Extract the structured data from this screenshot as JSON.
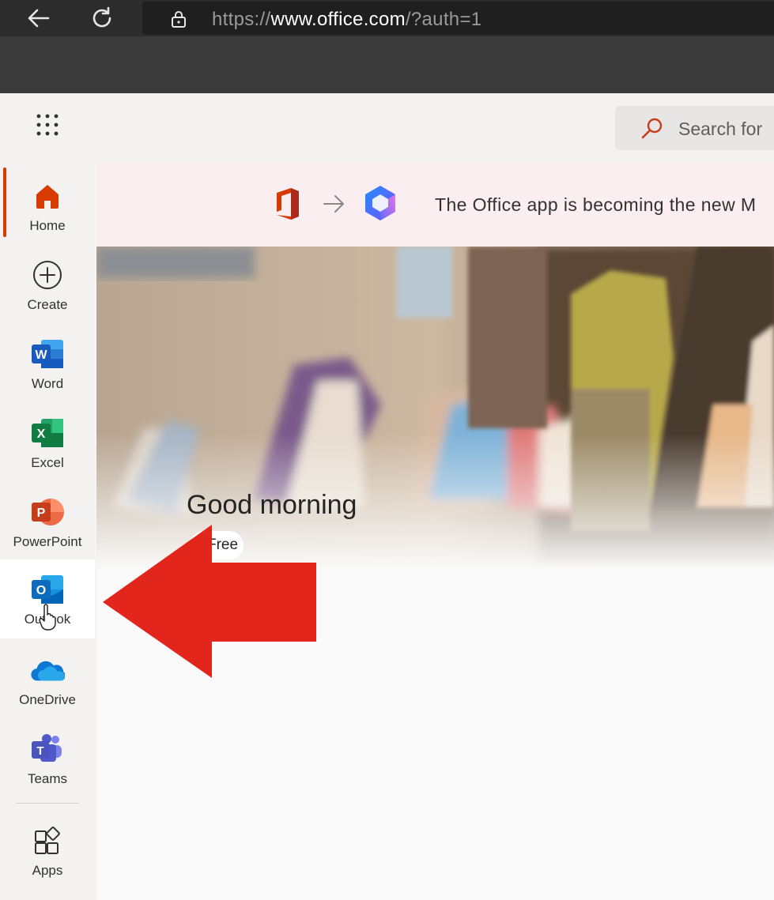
{
  "browser": {
    "url_scheme": "https://",
    "url_host": "www.office.com",
    "url_path": "/?auth=1"
  },
  "topbar": {
    "search_placeholder": "Search for"
  },
  "banner": {
    "text": "The Office app is becoming the new M"
  },
  "sidebar": {
    "items": [
      {
        "label": "Home",
        "icon": "home-icon"
      },
      {
        "label": "Create",
        "icon": "create-icon"
      },
      {
        "label": "Word",
        "icon": "word-icon"
      },
      {
        "label": "Excel",
        "icon": "excel-icon"
      },
      {
        "label": "PowerPoint",
        "icon": "powerpoint-icon"
      },
      {
        "label": "Outlook",
        "icon": "outlook-icon"
      },
      {
        "label": "OneDrive",
        "icon": "onedrive-icon"
      },
      {
        "label": "Teams",
        "icon": "teams-icon"
      },
      {
        "label": "Apps",
        "icon": "apps-icon"
      }
    ]
  },
  "hero": {
    "greeting": "Good morning",
    "pill_label": "Free"
  },
  "colors": {
    "accent": "#d83b01",
    "banner_bg": "#fbeef0",
    "arrow": "#e3261c"
  }
}
